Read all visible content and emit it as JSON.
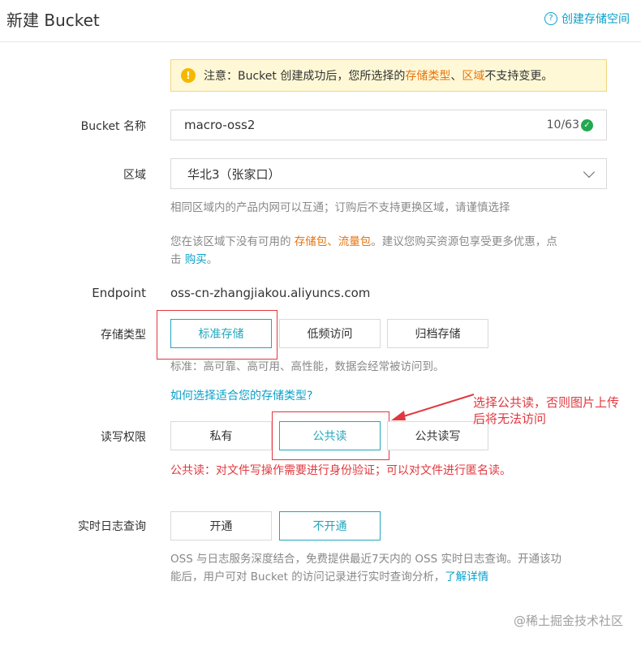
{
  "header": {
    "title": "新建 Bucket",
    "help_icon": "question-circle-icon",
    "help_link": "创建存储空间"
  },
  "notice": {
    "icon": "warning-icon",
    "prefix": "注意：Bucket 创建成功后，您所选择的",
    "highlight1": "存储类型",
    "sep": "、",
    "highlight2": "区域",
    "suffix": "不支持变更。"
  },
  "bucket_name": {
    "label": "Bucket 名称",
    "value": "macro-oss2",
    "counter": "10/63"
  },
  "region": {
    "label": "区域",
    "selected": "华北3（张家口）",
    "hint": "相同区域内的产品内网可以互通；订购后不支持更换区域，请谨慎选择",
    "tip_prefix": "您在该区域下没有可用的 ",
    "tip_link1": "存储包",
    "tip_sep": "、",
    "tip_link2": "流量包",
    "tip_mid": "。建议您购买资源包享受更多优惠，点",
    "tip_line2_prefix": "击 ",
    "tip_buy": "购买",
    "tip_end": "。"
  },
  "endpoint": {
    "label": "Endpoint",
    "value": "oss-cn-zhangjiakou.aliyuncs.com"
  },
  "storage_class": {
    "label": "存储类型",
    "options": [
      "标准存储",
      "低频访问",
      "归档存储"
    ],
    "selected": "标准存储",
    "hint": "标准：高可靠、高可用、高性能，数据会经常被访问到。",
    "help_link": "如何选择适合您的存储类型?"
  },
  "acl": {
    "label": "读写权限",
    "options": [
      "私有",
      "公共读",
      "公共读写"
    ],
    "selected": "公共读",
    "warning": "公共读：对文件写操作需要进行身份验证；可以对文件进行匿名读。"
  },
  "annotation": {
    "line1": "选择公共读，否则图片上传",
    "line2": "后将无法访问",
    "color": "#e0383e"
  },
  "realtime_log": {
    "label": "实时日志查询",
    "options": [
      "开通",
      "不开通"
    ],
    "selected": "不开通",
    "desc_line1": "OSS 与日志服务深度结合，免费提供最近7天内的 OSS 实时日志查询。开通该功",
    "desc_line2": "能后，用户可对 Bucket 的访问记录进行实时查询分析，",
    "desc_link": "了解详情"
  },
  "watermark": "@稀土掘金技术社区",
  "colors": {
    "accent": "#21a7bd",
    "link": "#0aa1c9",
    "orange": "#e8730c",
    "red": "#e0383e"
  }
}
